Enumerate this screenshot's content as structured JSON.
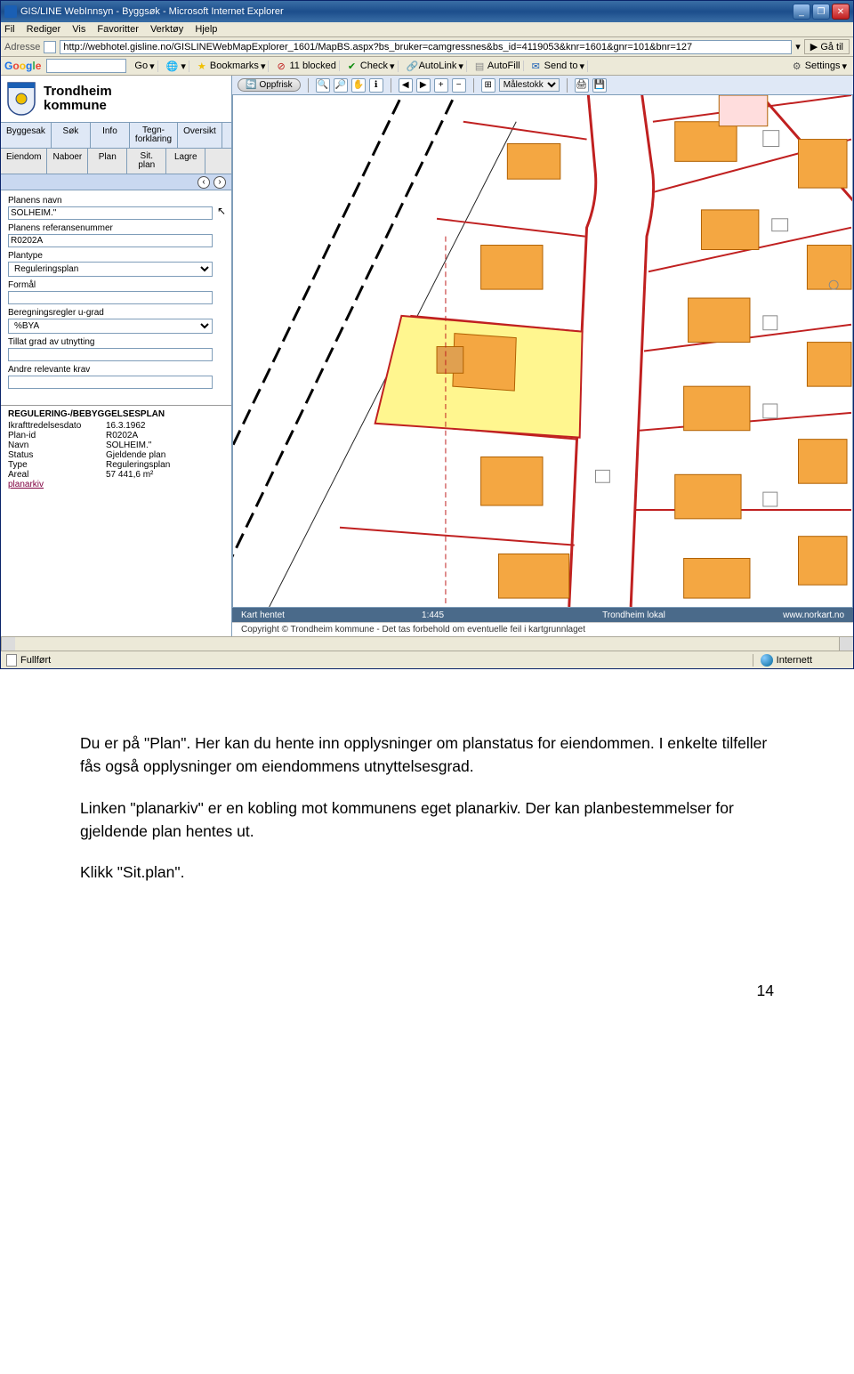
{
  "browser": {
    "title": "GIS/LINE WebInnsyn - Byggsøk - Microsoft Internet Explorer",
    "menus": [
      "Fil",
      "Rediger",
      "Vis",
      "Favoritter",
      "Verktøy",
      "Hjelp"
    ],
    "addr_label": "Adresse",
    "url": "http://webhotel.gisline.no/GISLINEWebMapExplorer_1601/MapBS.aspx?bs_bruker=camgressnes&bs_id=4119053&knr=1601&gnr=101&bnr=127",
    "go": "Gå til",
    "google_go": "Go",
    "bookmarks": "Bookmarks",
    "blocked": "11 blocked",
    "check": "Check",
    "autolink": "AutoLink",
    "autofill": "AutoFill",
    "sendto": "Send to",
    "settings": "Settings",
    "status_left": "Fullført",
    "status_zone": "Internett"
  },
  "app": {
    "kommune_l1": "Trondheim",
    "kommune_l2": "kommune",
    "tabs1": [
      "Byggesak",
      "Søk",
      "Info",
      "Tegn-\nforklaring",
      "Oversikt"
    ],
    "tabs2": [
      "Eiendom",
      "Naboer",
      "Plan",
      "Sit.\nplan",
      "Lagre"
    ],
    "form": {
      "planens_navn_label": "Planens navn",
      "planens_navn": "SOLHEIM.\"",
      "refnr_label": "Planens referansenummer",
      "refnr": "R0202A",
      "plantype_label": "Plantype",
      "plantype": "Reguleringsplan",
      "formal_label": "Formål",
      "formal": "",
      "bereg_label": "Beregningsregler u-grad",
      "bereg": "%BYA",
      "tillat_label": "Tillat grad av utnytting",
      "tillat": "",
      "andre_label": "Andre relevante krav",
      "andre": ""
    },
    "info": {
      "hdr": "REGULERING-/BEBYGGELSESPLAN",
      "rows": [
        {
          "k": "Ikrafttredelsesdato",
          "v": "16.3.1962"
        },
        {
          "k": "Plan-id",
          "v": "R0202A"
        },
        {
          "k": "Navn",
          "v": "SOLHEIM.\""
        },
        {
          "k": "Status",
          "v": "Gjeldende plan"
        },
        {
          "k": "Type",
          "v": "Reguleringsplan"
        },
        {
          "k": "Areal",
          "v": "57 441,6 m²"
        }
      ],
      "link": "planarkiv"
    },
    "map_toolbar": {
      "oppfrisk": "Oppfrisk",
      "scale_sel": "Målestokk"
    },
    "status": {
      "left": "Kart hentet",
      "scale": "1:445",
      "mid": "Trondheim lokal",
      "right": "www.norkart.no"
    },
    "copyright": "Copyright © Trondheim kommune - Det tas forbehold om eventuelle feil i kartgrunnlaget"
  },
  "doc": {
    "p1": "Du er på \"Plan\". Her kan du hente inn opplysninger om planstatus for eiendommen. I enkelte tilfeller fås også opplysninger om eiendommens utnyttelsesgrad.",
    "p2": "Linken \"planarkiv\" er en kobling mot kommunens eget planarkiv. Der kan planbestemmelser for gjeldende plan hentes ut.",
    "p3": "Klikk \"Sit.plan\".",
    "page": "14"
  }
}
